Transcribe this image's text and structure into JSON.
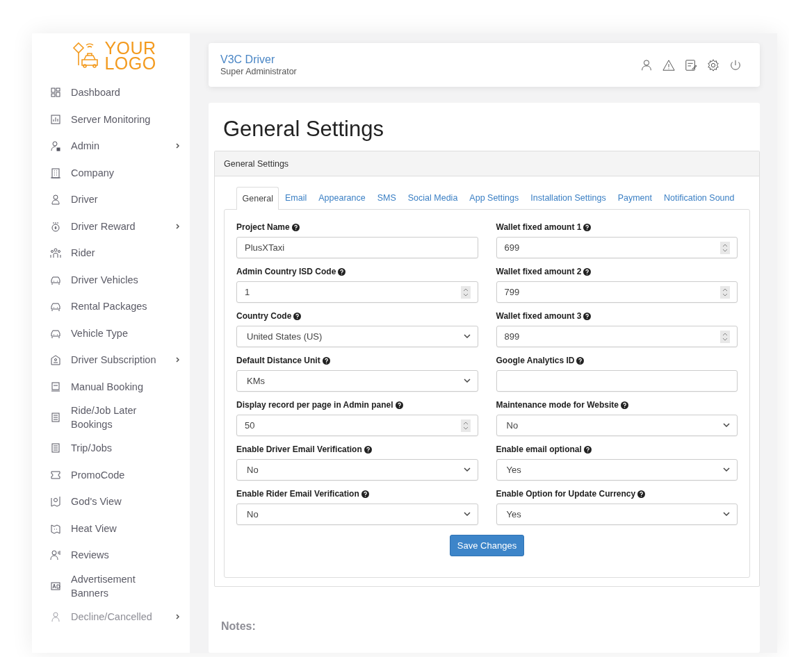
{
  "logo": {
    "line1": "YOUR",
    "line2": "LOGO"
  },
  "sidebar": {
    "items": [
      {
        "label": "Dashboard",
        "has_submenu": false
      },
      {
        "label": "Server Monitoring",
        "has_submenu": false
      },
      {
        "label": "Admin",
        "has_submenu": true
      },
      {
        "label": "Company",
        "has_submenu": false
      },
      {
        "label": "Driver",
        "has_submenu": false
      },
      {
        "label": "Driver Reward",
        "has_submenu": true
      },
      {
        "label": "Rider",
        "has_submenu": false
      },
      {
        "label": "Driver Vehicles",
        "has_submenu": false
      },
      {
        "label": "Rental Packages",
        "has_submenu": false
      },
      {
        "label": "Vehicle Type",
        "has_submenu": false
      },
      {
        "label": "Driver Subscription",
        "has_submenu": true
      },
      {
        "label": "Manual Booking",
        "has_submenu": false
      },
      {
        "label": "Ride/Job Later Bookings",
        "has_submenu": false
      },
      {
        "label": "Trip/Jobs",
        "has_submenu": false
      },
      {
        "label": "PromoCode",
        "has_submenu": false
      },
      {
        "label": "God's View",
        "has_submenu": false
      },
      {
        "label": "Heat View",
        "has_submenu": false
      },
      {
        "label": "Reviews",
        "has_submenu": false
      },
      {
        "label": "Advertisement Banners",
        "has_submenu": false
      },
      {
        "label": "Decline/Cancelled",
        "has_submenu": true
      }
    ]
  },
  "header": {
    "title": "V3C Driver",
    "subtitle": "Super Administrator"
  },
  "page_title": "General Settings",
  "panel": {
    "heading": "General Settings",
    "tabs": [
      {
        "label": "General",
        "selected": true
      },
      {
        "label": "Email",
        "selected": false
      },
      {
        "label": "Appearance",
        "selected": false
      },
      {
        "label": "SMS",
        "selected": false
      },
      {
        "label": "Social Media",
        "selected": false
      },
      {
        "label": "App Settings",
        "selected": false
      },
      {
        "label": "Installation Settings",
        "selected": false
      },
      {
        "label": "Payment",
        "selected": false
      },
      {
        "label": "Notification Sound",
        "selected": false
      }
    ],
    "fields": [
      {
        "label": "Project Name",
        "kind": "text",
        "value": "PlusXTaxi"
      },
      {
        "label": "Wallet fixed amount 1",
        "kind": "number",
        "value": "699"
      },
      {
        "label": "Admin Country ISD Code",
        "kind": "number",
        "value": "1"
      },
      {
        "label": "Wallet fixed amount 2",
        "kind": "number",
        "value": "799"
      },
      {
        "label": "Country Code",
        "kind": "select",
        "value": "United States (US)"
      },
      {
        "label": "Wallet fixed amount 3",
        "kind": "number",
        "value": "899"
      },
      {
        "label": "Default Distance Unit",
        "kind": "select",
        "value": "KMs"
      },
      {
        "label": "Google Analytics ID",
        "kind": "text"
      },
      {
        "label": "Display record per page in Admin panel",
        "kind": "number",
        "value": "50"
      },
      {
        "label": "Maintenance mode for Website",
        "kind": "select",
        "value": "No"
      },
      {
        "label": "Enable Driver Email Verification",
        "kind": "select",
        "value": "No"
      },
      {
        "label": "Enable email optional",
        "kind": "select",
        "value": "Yes"
      },
      {
        "label": "Enable Rider Email Verification",
        "kind": "select",
        "value": "No"
      },
      {
        "label": "Enable Option for Update Currency",
        "kind": "select",
        "value": "Yes"
      }
    ],
    "save_button": "Save Changes"
  },
  "notes_label": "Notes:"
}
